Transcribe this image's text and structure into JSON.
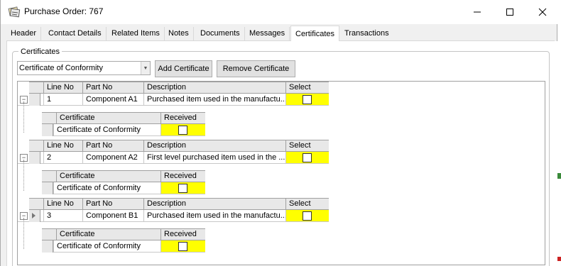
{
  "window": {
    "title": "Purchase Order: 767"
  },
  "tabs": [
    "Header",
    "Contact Details",
    "Related Items",
    "Notes",
    "Documents",
    "Messages",
    "Certificates",
    "Transactions"
  ],
  "active_tab": "Certificates",
  "certificates": {
    "group_title": "Certificates",
    "combo_value": "Certificate of Conformity",
    "add_button": "Add Certificate",
    "remove_button": "Remove Certificate"
  },
  "grid": {
    "columns": {
      "line_no": "Line No",
      "part_no": "Part No",
      "description": "Description",
      "select": "Select"
    },
    "child_columns": {
      "certificate": "Certificate",
      "received": "Received"
    },
    "rows": [
      {
        "line_no": "1",
        "part_no": "Component A1",
        "description": "Purchased item used in the manufactu...",
        "expanded": true,
        "current": false,
        "children": [
          {
            "certificate": "Certificate of Conformity",
            "received": false
          }
        ]
      },
      {
        "line_no": "2",
        "part_no": "Component A2",
        "description": "First level purchased item used in the ...",
        "expanded": true,
        "current": false,
        "children": [
          {
            "certificate": "Certificate of Conformity",
            "received": false
          }
        ]
      },
      {
        "line_no": "3",
        "part_no": "Component B1",
        "description": "Purchased item used in the manufactu...",
        "expanded": true,
        "current": true,
        "children": [
          {
            "certificate": "Certificate of Conformity",
            "received": false
          }
        ]
      }
    ]
  },
  "colors": {
    "highlight": "#ffff00",
    "tab_border": "#d9d9d9"
  },
  "icons": {
    "app": "app-icon",
    "minimize": "minimize-icon",
    "maximize": "maximize-icon",
    "close": "close-icon",
    "dropdown": "chevron-down-icon"
  }
}
